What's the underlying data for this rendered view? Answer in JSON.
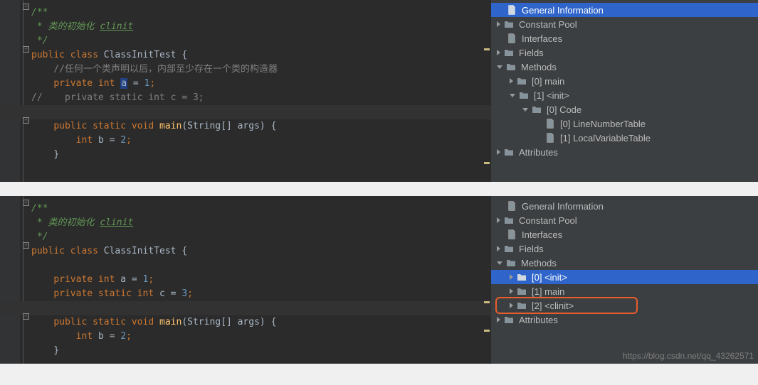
{
  "panel1": {
    "code": [
      {
        "t": "jdoc",
        "txt": "/**",
        "fold": "minus"
      },
      {
        "t": "jdoc",
        "txt": " * 类的初始化 ",
        "link": "clinit"
      },
      {
        "t": "jdoc",
        "txt": " */"
      },
      {
        "t": "code",
        "parts": [
          {
            "c": "kw",
            "v": "public class "
          },
          {
            "c": "cls",
            "v": "ClassInitTest {"
          }
        ],
        "fold": "minus",
        "warn": true
      },
      {
        "t": "comment",
        "txt": "    //任何一个类声明以后，内部至少存在一个类的构造器"
      },
      {
        "t": "code",
        "parts": [
          {
            "c": "",
            "v": "    "
          },
          {
            "c": "kw",
            "v": "private int "
          },
          {
            "c": "sel",
            "v": "a"
          },
          {
            "c": "",
            "v": " = "
          },
          {
            "c": "num",
            "v": "1"
          },
          {
            "c": "kw",
            "v": ";"
          }
        ]
      },
      {
        "t": "comment",
        "txt": "//    private static int c = 3;"
      },
      {
        "t": "blank",
        "highlight": true
      },
      {
        "t": "code",
        "parts": [
          {
            "c": "",
            "v": "    "
          },
          {
            "c": "kw",
            "v": "public static void "
          },
          {
            "c": "fn",
            "v": "main"
          },
          {
            "c": "",
            "v": "(String[] args) {"
          }
        ],
        "fold": "minus"
      },
      {
        "t": "code",
        "parts": [
          {
            "c": "",
            "v": "        "
          },
          {
            "c": "kw",
            "v": "int "
          },
          {
            "c": "",
            "v": "b = "
          },
          {
            "c": "num",
            "v": "2"
          },
          {
            "c": "kw",
            "v": ";"
          }
        ]
      },
      {
        "t": "code",
        "parts": [
          {
            "c": "",
            "v": "    }"
          }
        ]
      },
      {
        "t": "blank",
        "warn": true
      }
    ],
    "tree": [
      {
        "indent": 0,
        "arrow": "none",
        "icon": "file",
        "label": "General Information",
        "selected": true
      },
      {
        "indent": 0,
        "arrow": "right",
        "icon": "folder",
        "label": "Constant Pool"
      },
      {
        "indent": 0,
        "arrow": "none",
        "icon": "file",
        "label": "Interfaces"
      },
      {
        "indent": 0,
        "arrow": "right",
        "icon": "folder",
        "label": "Fields"
      },
      {
        "indent": 0,
        "arrow": "down",
        "icon": "folder",
        "label": "Methods"
      },
      {
        "indent": 1,
        "arrow": "right",
        "icon": "folder",
        "label": "[0] main"
      },
      {
        "indent": 1,
        "arrow": "down",
        "icon": "folder",
        "label": "[1] <init>"
      },
      {
        "indent": 2,
        "arrow": "down",
        "icon": "folder",
        "label": "[0] Code"
      },
      {
        "indent": 3,
        "arrow": "none",
        "icon": "file",
        "label": "[0] LineNumberTable"
      },
      {
        "indent": 3,
        "arrow": "none",
        "icon": "file",
        "label": "[1] LocalVariableTable"
      },
      {
        "indent": 0,
        "arrow": "right",
        "icon": "folder",
        "label": "Attributes"
      }
    ]
  },
  "panel2": {
    "code": [
      {
        "t": "jdoc",
        "txt": "/**",
        "fold": "minus"
      },
      {
        "t": "jdoc",
        "txt": " * 类的初始化 ",
        "link": "clinit"
      },
      {
        "t": "jdoc",
        "txt": " */"
      },
      {
        "t": "code",
        "parts": [
          {
            "c": "kw",
            "v": "public class "
          },
          {
            "c": "cls",
            "v": "ClassInitTest {"
          }
        ],
        "fold": "minus"
      },
      {
        "t": "blank"
      },
      {
        "t": "code",
        "parts": [
          {
            "c": "",
            "v": "    "
          },
          {
            "c": "kw",
            "v": "private int "
          },
          {
            "c": "",
            "v": "a = "
          },
          {
            "c": "num",
            "v": "1"
          },
          {
            "c": "kw",
            "v": ";"
          }
        ]
      },
      {
        "t": "code",
        "parts": [
          {
            "c": "",
            "v": "    "
          },
          {
            "c": "kw",
            "v": "private static int "
          },
          {
            "c": "",
            "v": "c = "
          },
          {
            "c": "num",
            "v": "3"
          },
          {
            "c": "kw",
            "v": ";"
          }
        ]
      },
      {
        "t": "blank",
        "highlight": true,
        "warn": true
      },
      {
        "t": "code",
        "parts": [
          {
            "c": "",
            "v": "    "
          },
          {
            "c": "kw",
            "v": "public static void "
          },
          {
            "c": "fn",
            "v": "main"
          },
          {
            "c": "",
            "v": "(String[] args) {"
          }
        ],
        "fold": "minus"
      },
      {
        "t": "code",
        "parts": [
          {
            "c": "",
            "v": "        "
          },
          {
            "c": "kw",
            "v": "int "
          },
          {
            "c": "",
            "v": "b = "
          },
          {
            "c": "num",
            "v": "2"
          },
          {
            "c": "kw",
            "v": ";"
          }
        ],
        "warn": true
      },
      {
        "t": "code",
        "parts": [
          {
            "c": "",
            "v": "    }"
          }
        ]
      }
    ],
    "tree": [
      {
        "indent": 0,
        "arrow": "none",
        "icon": "file",
        "label": "General Information"
      },
      {
        "indent": 0,
        "arrow": "right",
        "icon": "folder",
        "label": "Constant Pool"
      },
      {
        "indent": 0,
        "arrow": "none",
        "icon": "file",
        "label": "Interfaces"
      },
      {
        "indent": 0,
        "arrow": "right",
        "icon": "folder",
        "label": "Fields"
      },
      {
        "indent": 0,
        "arrow": "down",
        "icon": "folder",
        "label": "Methods"
      },
      {
        "indent": 1,
        "arrow": "right",
        "icon": "folder",
        "label": "[0] <init>",
        "selected": true
      },
      {
        "indent": 1,
        "arrow": "right",
        "icon": "folder",
        "label": "[1] main"
      },
      {
        "indent": 1,
        "arrow": "right",
        "icon": "folder",
        "label": "[2] <clinit>",
        "boxed": true
      },
      {
        "indent": 0,
        "arrow": "right",
        "icon": "folder",
        "label": "Attributes"
      }
    ]
  },
  "watermark": "https://blog.csdn.net/qq_43262571"
}
